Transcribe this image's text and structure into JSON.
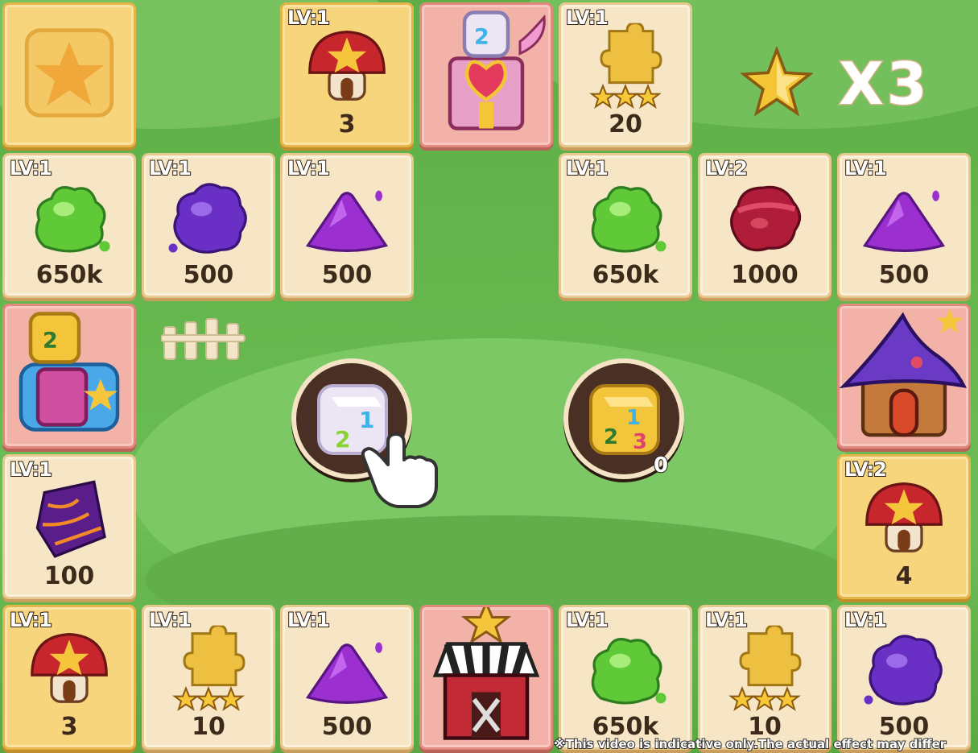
{
  "multiplier": {
    "label": "X3"
  },
  "tiles": [
    {
      "id": "start-tile",
      "style": "gold",
      "kind": "star",
      "lv": "",
      "value": ""
    },
    {
      "id": "tile-mushroom-top",
      "style": "gold",
      "kind": "mushroom",
      "lv": "LV:1",
      "value": "3"
    },
    {
      "id": "tile-dice-chest-top",
      "style": "pink",
      "kind": "dice-chest",
      "lv": "",
      "value": ""
    },
    {
      "id": "tile-puzzle-top",
      "style": "cream",
      "kind": "puzzle",
      "lv": "LV:1",
      "value": "20"
    },
    {
      "id": "tile-green-slime-1",
      "style": "cream",
      "kind": "green-slime",
      "lv": "LV:1",
      "value": "650k"
    },
    {
      "id": "tile-purple-slime-1",
      "style": "cream",
      "kind": "purple-slime",
      "lv": "LV:1",
      "value": "500"
    },
    {
      "id": "tile-purple-pile-1",
      "style": "cream",
      "kind": "purple-pile",
      "lv": "LV:1",
      "value": "500"
    },
    {
      "id": "tile-green-slime-2",
      "style": "cream",
      "kind": "green-slime",
      "lv": "LV:1",
      "value": "650k"
    },
    {
      "id": "tile-red-slime",
      "style": "cream",
      "kind": "red-slime",
      "lv": "LV:2",
      "value": "1000"
    },
    {
      "id": "tile-purple-pile-2",
      "style": "cream",
      "kind": "purple-pile",
      "lv": "LV:1",
      "value": "500"
    },
    {
      "id": "tile-blue-chest-left",
      "style": "pink",
      "kind": "blue-chest",
      "lv": "",
      "value": ""
    },
    {
      "id": "tile-wizard-house",
      "style": "pink",
      "kind": "wizard-house",
      "lv": "",
      "value": ""
    },
    {
      "id": "tile-crystal-left",
      "style": "cream",
      "kind": "crystal",
      "lv": "LV:1",
      "value": "100"
    },
    {
      "id": "tile-mushroom-right",
      "style": "gold",
      "kind": "mushroom",
      "lv": "LV:2",
      "value": "4"
    },
    {
      "id": "tile-mushroom-bottom",
      "style": "gold",
      "kind": "mushroom",
      "lv": "LV:1",
      "value": "3"
    },
    {
      "id": "tile-puzzle-bottom-1",
      "style": "cream",
      "kind": "puzzle",
      "lv": "LV:1",
      "value": "10"
    },
    {
      "id": "tile-purple-pile-3",
      "style": "cream",
      "kind": "purple-pile",
      "lv": "LV:1",
      "value": "500"
    },
    {
      "id": "tile-shop",
      "style": "pink",
      "kind": "shop",
      "lv": "",
      "value": ""
    },
    {
      "id": "tile-green-slime-3",
      "style": "cream",
      "kind": "green-slime",
      "lv": "LV:1",
      "value": "650k"
    },
    {
      "id": "tile-puzzle-bottom-2",
      "style": "cream",
      "kind": "puzzle",
      "lv": "LV:1",
      "value": "10"
    },
    {
      "id": "tile-purple-slime-2",
      "style": "cream",
      "kind": "purple-slime",
      "lv": "LV:1",
      "value": "500"
    }
  ],
  "dice": {
    "normal_label": "",
    "golden_count": "0"
  },
  "disclaimer": "※This video is indicative only.The actual effect may differ"
}
